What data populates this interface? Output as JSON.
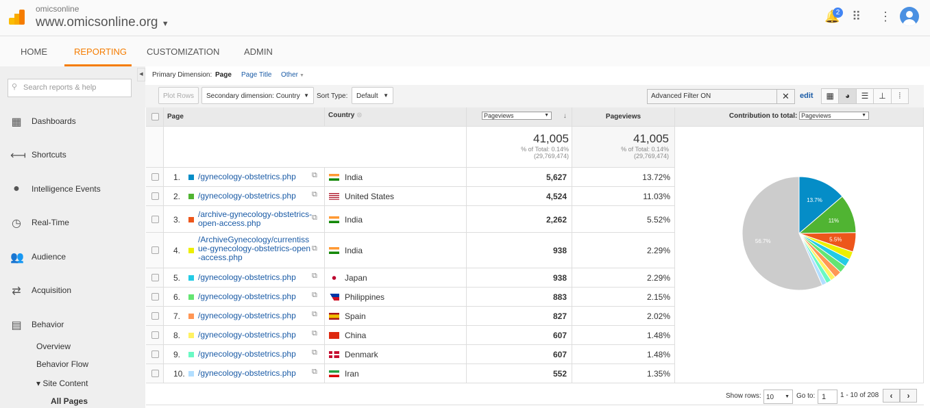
{
  "header": {
    "account": "omicsonline",
    "property": "www.omicsonline.org",
    "notification_count": "2"
  },
  "nav": {
    "tabs": [
      "HOME",
      "REPORTING",
      "CUSTOMIZATION",
      "ADMIN"
    ],
    "active": "REPORTING"
  },
  "sidebar": {
    "search_placeholder": "Search reports & help",
    "items": [
      {
        "label": "Dashboards",
        "icon": "grid-icon"
      },
      {
        "label": "Shortcuts",
        "icon": "shortcut-arrow-icon"
      },
      {
        "label": "Intelligence Events",
        "icon": "lightbulb-icon"
      },
      {
        "label": "Real-Time",
        "icon": "clock-icon"
      },
      {
        "label": "Audience",
        "icon": "people-icon"
      },
      {
        "label": "Acquisition",
        "icon": "arrows-icon"
      },
      {
        "label": "Behavior",
        "icon": "layout-icon"
      }
    ],
    "sub_items": [
      "Overview",
      "Behavior Flow",
      "▾ Site Content",
      "All Pages"
    ]
  },
  "toolbar": {
    "primary_label": "Primary Dimension:",
    "primary_page": "Page",
    "page_title": "Page Title",
    "other": "Other",
    "plot_rows": "Plot Rows",
    "secondary": "Secondary dimension: Country",
    "sort_type_label": "Sort Type:",
    "sort_type": "Default",
    "filter": "Advanced Filter ON",
    "edit": "edit"
  },
  "table": {
    "headers": {
      "page": "Page",
      "country": "Country",
      "metric_select": "Pageviews",
      "pageviews": "Pageviews",
      "contribution": "Contribution to total:",
      "contribution_select": "Pageviews"
    },
    "totals": {
      "value": "41,005",
      "pct": "% of Total: 0.14%",
      "of": "(29,769,474)"
    },
    "rows": [
      {
        "n": "1.",
        "page": "/gynecology-obstetrics.php",
        "country": "India",
        "pv": "5,627",
        "pct": "13.72%",
        "color": "#058dc7"
      },
      {
        "n": "2.",
        "page": "/gynecology-obstetrics.php",
        "country": "United States",
        "pv": "4,524",
        "pct": "11.03%",
        "color": "#50b432"
      },
      {
        "n": "3.",
        "page": "/archive-gynecology-obstetrics-open-access.php",
        "country": "India",
        "pv": "2,262",
        "pct": "5.52%",
        "color": "#ed561b"
      },
      {
        "n": "4.",
        "page": "/ArchiveGynecology/currentissue-gynecology-obstetrics-open-access.php",
        "country": "India",
        "pv": "938",
        "pct": "2.29%",
        "color": "#edef00"
      },
      {
        "n": "5.",
        "page": "/gynecology-obstetrics.php",
        "country": "Japan",
        "pv": "938",
        "pct": "2.29%",
        "color": "#24cbe5"
      },
      {
        "n": "6.",
        "page": "/gynecology-obstetrics.php",
        "country": "Philippines",
        "pv": "883",
        "pct": "2.15%",
        "color": "#64e572"
      },
      {
        "n": "7.",
        "page": "/gynecology-obstetrics.php",
        "country": "Spain",
        "pv": "827",
        "pct": "2.02%",
        "color": "#ff9655"
      },
      {
        "n": "8.",
        "page": "/gynecology-obstetrics.php",
        "country": "China",
        "pv": "607",
        "pct": "1.48%",
        "color": "#fff263"
      },
      {
        "n": "9.",
        "page": "/gynecology-obstetrics.php",
        "country": "Denmark",
        "pv": "607",
        "pct": "1.48%",
        "color": "#6af9c4"
      },
      {
        "n": "10.",
        "page": "/gynecology-obstetrics.php",
        "country": "Iran",
        "pv": "552",
        "pct": "1.35%",
        "color": "#b2deff"
      }
    ]
  },
  "chart_data": {
    "type": "pie",
    "values": [
      13.72,
      11.03,
      5.52,
      2.29,
      2.29,
      2.15,
      2.02,
      1.48,
      1.48,
      1.35,
      56.67
    ],
    "colors": [
      "#058dc7",
      "#50b432",
      "#ed561b",
      "#edef00",
      "#24cbe5",
      "#64e572",
      "#ff9655",
      "#fff263",
      "#6af9c4",
      "#b2deff",
      "#cccccc"
    ],
    "labels": [
      "13.7%",
      "11%",
      "5.5%",
      "",
      "",
      "",
      "",
      "",
      "",
      "",
      "56.7%"
    ]
  },
  "footer": {
    "show_rows_label": "Show rows:",
    "show_rows": "10",
    "goto_label": "Go to:",
    "goto": "1",
    "range": "1 - 10 of 208"
  }
}
